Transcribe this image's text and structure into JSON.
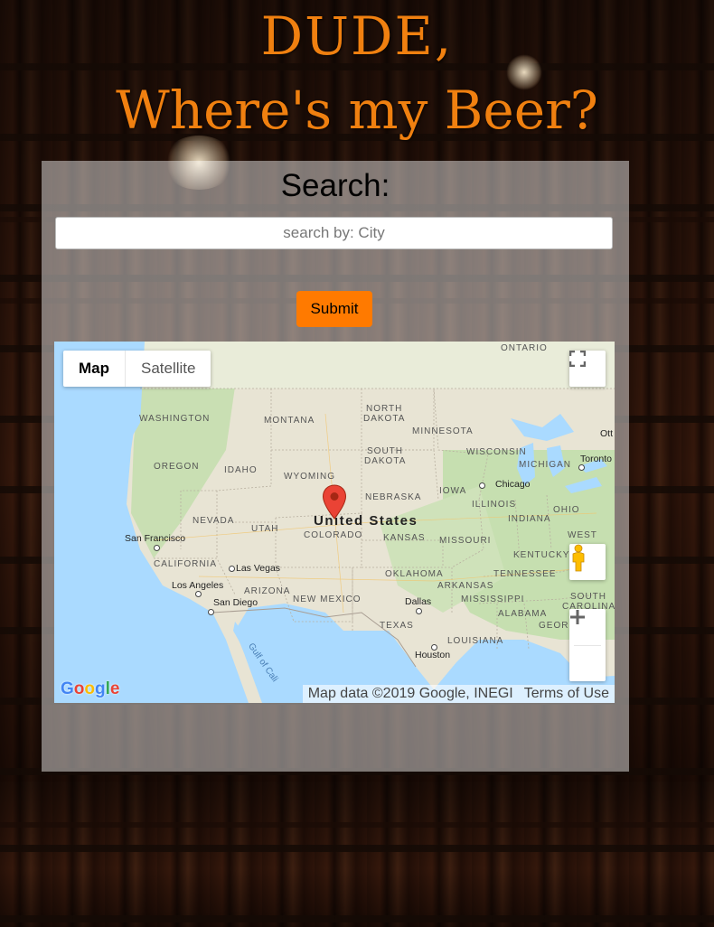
{
  "header": {
    "title_line1": "DUDE,",
    "title_line2": "Where's my Beer?"
  },
  "search": {
    "label": "Search:",
    "placeholder": "search by: City",
    "value": "",
    "submit_label": "Submit"
  },
  "map": {
    "type_options": [
      "Map",
      "Satellite"
    ],
    "active_type": "Map",
    "country_label": "United States",
    "labels": {
      "washington": "WASHINGTON",
      "montana": "MONTANA",
      "north_dakota_1": "NORTH",
      "north_dakota_2": "DAKOTA",
      "minnesota": "MINNESOTA",
      "ontario": "ONTARIO",
      "oregon": "OREGON",
      "idaho": "IDAHO",
      "wyoming": "WYOMING",
      "south_dakota_1": "SOUTH",
      "south_dakota_2": "DAKOTA",
      "wisconsin": "WISCONSIN",
      "michigan": "MICHIGAN",
      "nevada": "NEVADA",
      "utah": "UTAH",
      "colorado": "COLORADO",
      "nebraska": "NEBRASKA",
      "iowa": "IOWA",
      "illinois": "ILLINOIS",
      "indiana": "INDIANA",
      "ohio": "OHIO",
      "kansas": "KANSAS",
      "missouri": "MISSOURI",
      "california": "CALIFORNIA",
      "arizona": "ARIZONA",
      "new_mexico": "NEW MEXICO",
      "oklahoma": "OKLAHOMA",
      "arkansas": "ARKANSAS",
      "tennessee": "TENNESSEE",
      "kentucky": "KENTUCKY",
      "west": "WEST",
      "south_carolina_1": "SOUTH",
      "south_carolina_2": "CAROLINA",
      "mississippi": "MISSISSIPPI",
      "alabama": "ALABAMA",
      "georgia": "GEORG",
      "texas": "TEXAS",
      "louisiana": "LOUISIANA",
      "gulf": "Gulf of Cali"
    },
    "cities": {
      "san_francisco": "San Francisco",
      "las_vegas": "Las Vegas",
      "los_angeles": "Los Angeles",
      "san_diego": "San Diego",
      "dallas": "Dallas",
      "houston": "Houston",
      "chicago": "Chicago",
      "toronto": "Toronto",
      "ottawa": "Ott"
    },
    "logo": "Google",
    "attribution": "Map data ©2019 Google, INEGI",
    "terms": "Terms of Use"
  },
  "colors": {
    "title": "#f08010",
    "submit_button": "#ff7a00",
    "map_water": "#aadaff",
    "map_land": "#e8e4d4",
    "marker": "#ea4335"
  },
  "icons": [
    "fullscreen-icon",
    "pegman-icon",
    "zoom-in-icon",
    "zoom-out-icon",
    "map-marker-icon"
  ]
}
